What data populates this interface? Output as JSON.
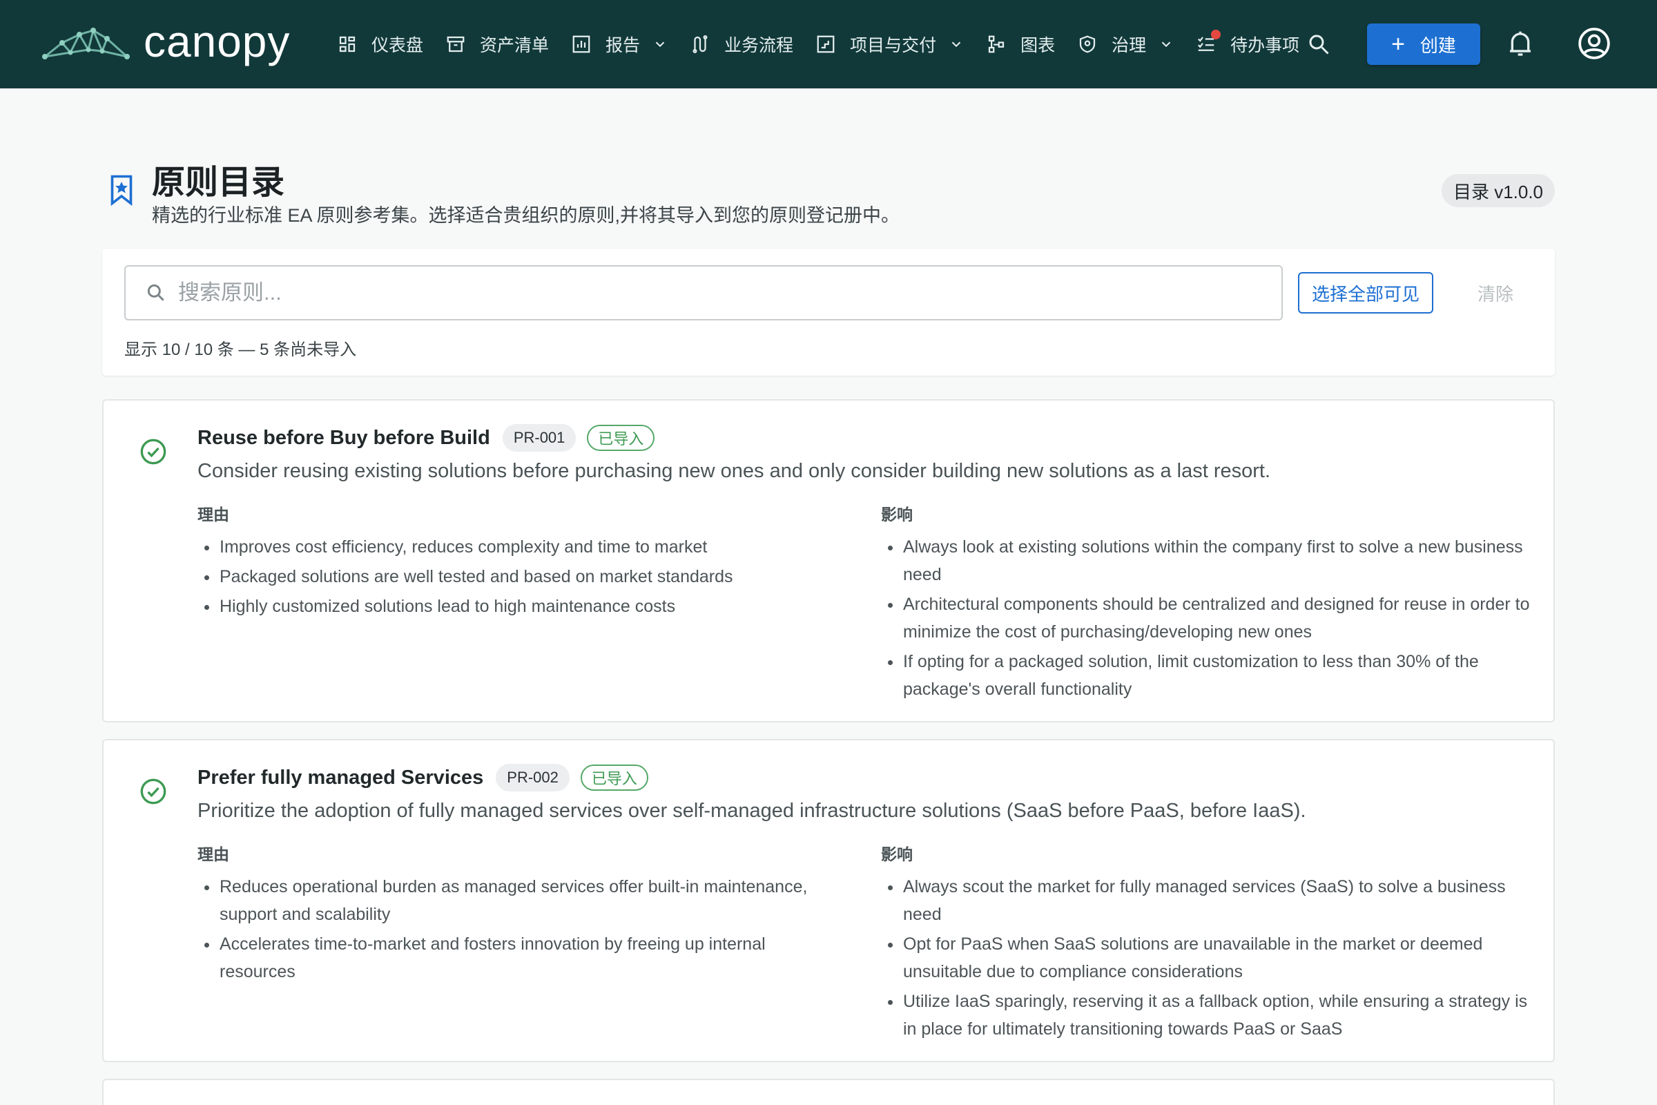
{
  "app": {
    "brand": "canopy"
  },
  "nav": {
    "items": [
      {
        "label": "仪表盘",
        "icon": "dashboard-icon",
        "dropdown": false
      },
      {
        "label": "资产清单",
        "icon": "archive-icon",
        "dropdown": false
      },
      {
        "label": "报告",
        "icon": "report-chart-icon",
        "dropdown": true
      },
      {
        "label": "业务流程",
        "icon": "process-route-icon",
        "dropdown": false
      },
      {
        "label": "项目与交付",
        "icon": "project-icon",
        "dropdown": true
      },
      {
        "label": "图表",
        "icon": "diagram-icon",
        "dropdown": false
      },
      {
        "label": "治理",
        "icon": "shield-icon",
        "dropdown": true
      },
      {
        "label": "待办事项",
        "icon": "checklist-icon",
        "dropdown": false,
        "has_notification_dot": true
      }
    ],
    "create_label": "创建"
  },
  "page": {
    "title": "原则目录",
    "subtitle": "精选的行业标准 EA 原则参考集。选择适合贵组织的原则,并将其导入到您的原则登记册中。",
    "version": "目录 v1.0.0"
  },
  "search": {
    "placeholder": "搜索原则...",
    "value": "",
    "select_all_label": "选择全部可见",
    "clear_label": "清除",
    "result_count": "显示 10 / 10 条 — 5 条尚未导入"
  },
  "labels": {
    "rationale": "理由",
    "implications": "影响"
  },
  "principles": [
    {
      "title": "Reuse before Buy before Build",
      "id": "PR-001",
      "status": "已导入",
      "description": "Consider reusing existing solutions before purchasing new ones and only consider building new solutions as a last resort.",
      "rationale": [
        "Improves cost efficiency, reduces complexity and time to market",
        "Packaged solutions are well tested and based on market standards",
        "Highly customized solutions lead to high maintenance costs"
      ],
      "implications": [
        "Always look at existing solutions within the company first to solve a new business need",
        "Architectural components should be centralized and designed for reuse in order to minimize the cost of purchasing/developing new ones",
        "If opting for a packaged solution, limit customization to less than 30% of the package's overall functionality"
      ]
    },
    {
      "title": "Prefer fully managed Services",
      "id": "PR-002",
      "status": "已导入",
      "description": "Prioritize the adoption of fully managed services over self-managed infrastructure solutions (SaaS before PaaS, before IaaS).",
      "rationale": [
        "Reduces operational burden as managed services offer built-in maintenance, support and scalability",
        "Accelerates time-to-market and fosters innovation by freeing up internal resources"
      ],
      "implications": [
        "Always scout the market for fully managed services (SaaS) to solve a business need",
        "Opt for PaaS when SaaS solutions are unavailable in the market or deemed unsuitable due to compliance considerations",
        "Utilize IaaS sparingly, reserving it as a fallback option, while ensuring a strategy is in place for ultimately transitioning towards PaaS or SaaS"
      ]
    }
  ],
  "colors": {
    "topbar": "#12393a",
    "primary": "#1d6fd2",
    "success": "#3d9a52",
    "notification": "#e5483f"
  }
}
